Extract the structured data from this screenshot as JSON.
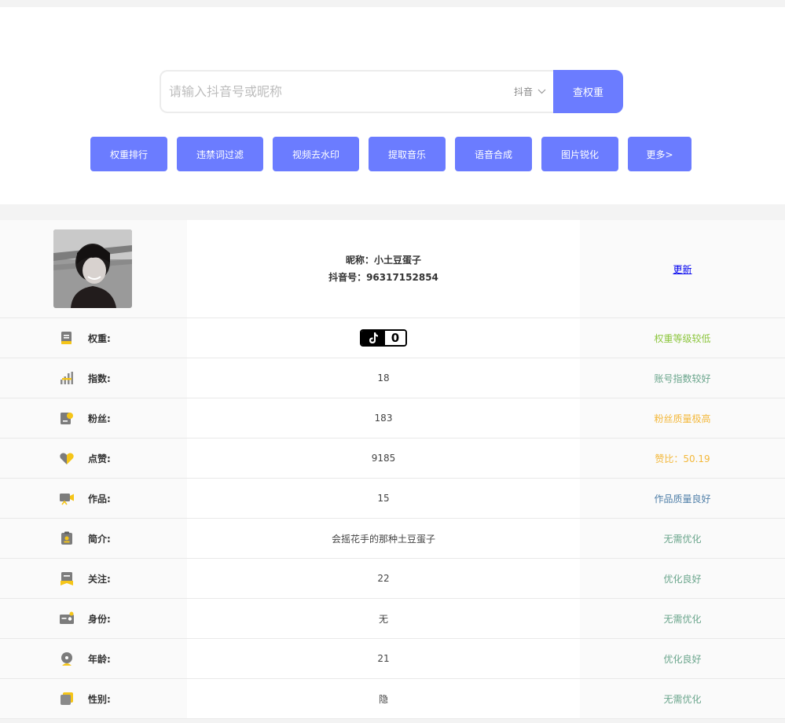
{
  "search": {
    "placeholder": "请输入抖音号或昵称",
    "platform": "抖音",
    "button_label": "查权重"
  },
  "tools": [
    {
      "label": "权重排行",
      "name": "tool-rank-button"
    },
    {
      "label": "违禁词过滤",
      "name": "tool-banned-words-button"
    },
    {
      "label": "视频去水印",
      "name": "tool-remove-watermark-button"
    },
    {
      "label": "提取音乐",
      "name": "tool-extract-music-button"
    },
    {
      "label": "语音合成",
      "name": "tool-tts-button"
    },
    {
      "label": "图片锐化",
      "name": "tool-sharpen-button"
    },
    {
      "label": "更多>",
      "name": "tool-more-button"
    }
  ],
  "profile": {
    "nickname_line": "昵称：小土豆蛋子",
    "account_line": "抖音号：96317152854",
    "update_label": "更新"
  },
  "weight": {
    "label": "权重:",
    "value": "0",
    "status": "权重等级较低",
    "status_color": "#8dc63f"
  },
  "stats": [
    {
      "label": "指数:",
      "value": "18",
      "status": "账号指数较好",
      "status_color": "#6aa58c",
      "icon": "bar-chart-icon"
    },
    {
      "label": "粉丝:",
      "value": "183",
      "status": "粉丝质量极高",
      "status_color": "#f3b83b",
      "icon": "fans-icon"
    },
    {
      "label": "点赞:",
      "value": "9185",
      "status": "赞比：50.19",
      "status_color": "#f3b83b",
      "icon": "heart-icon"
    },
    {
      "label": "作品:",
      "value": "15",
      "status": "作品质量良好",
      "status_color": "#4f7fa8",
      "icon": "video-camera-icon"
    },
    {
      "label": "简介:",
      "value": "会摇花手的那种土豆蛋子",
      "status": "无需优化",
      "status_color": "#6aa58c",
      "icon": "profile-card-icon"
    },
    {
      "label": "关注:",
      "value": "22",
      "status": "优化良好",
      "status_color": "#6aa58c",
      "icon": "bookmark-icon"
    },
    {
      "label": "身份:",
      "value": "无",
      "status": "无需优化",
      "status_color": "#6aa58c",
      "icon": "id-card-icon"
    },
    {
      "label": "年龄:",
      "value": "21",
      "status": "优化良好",
      "status_color": "#6aa58c",
      "icon": "age-icon"
    },
    {
      "label": "性别:",
      "value": "隐",
      "status": "无需优化",
      "status_color": "#6aa58c",
      "icon": "gender-icon"
    }
  ],
  "colors": {
    "accent": "#6b7cff",
    "icon_gray": "#8a8a8a",
    "icon_yellow": "#f5c518"
  }
}
